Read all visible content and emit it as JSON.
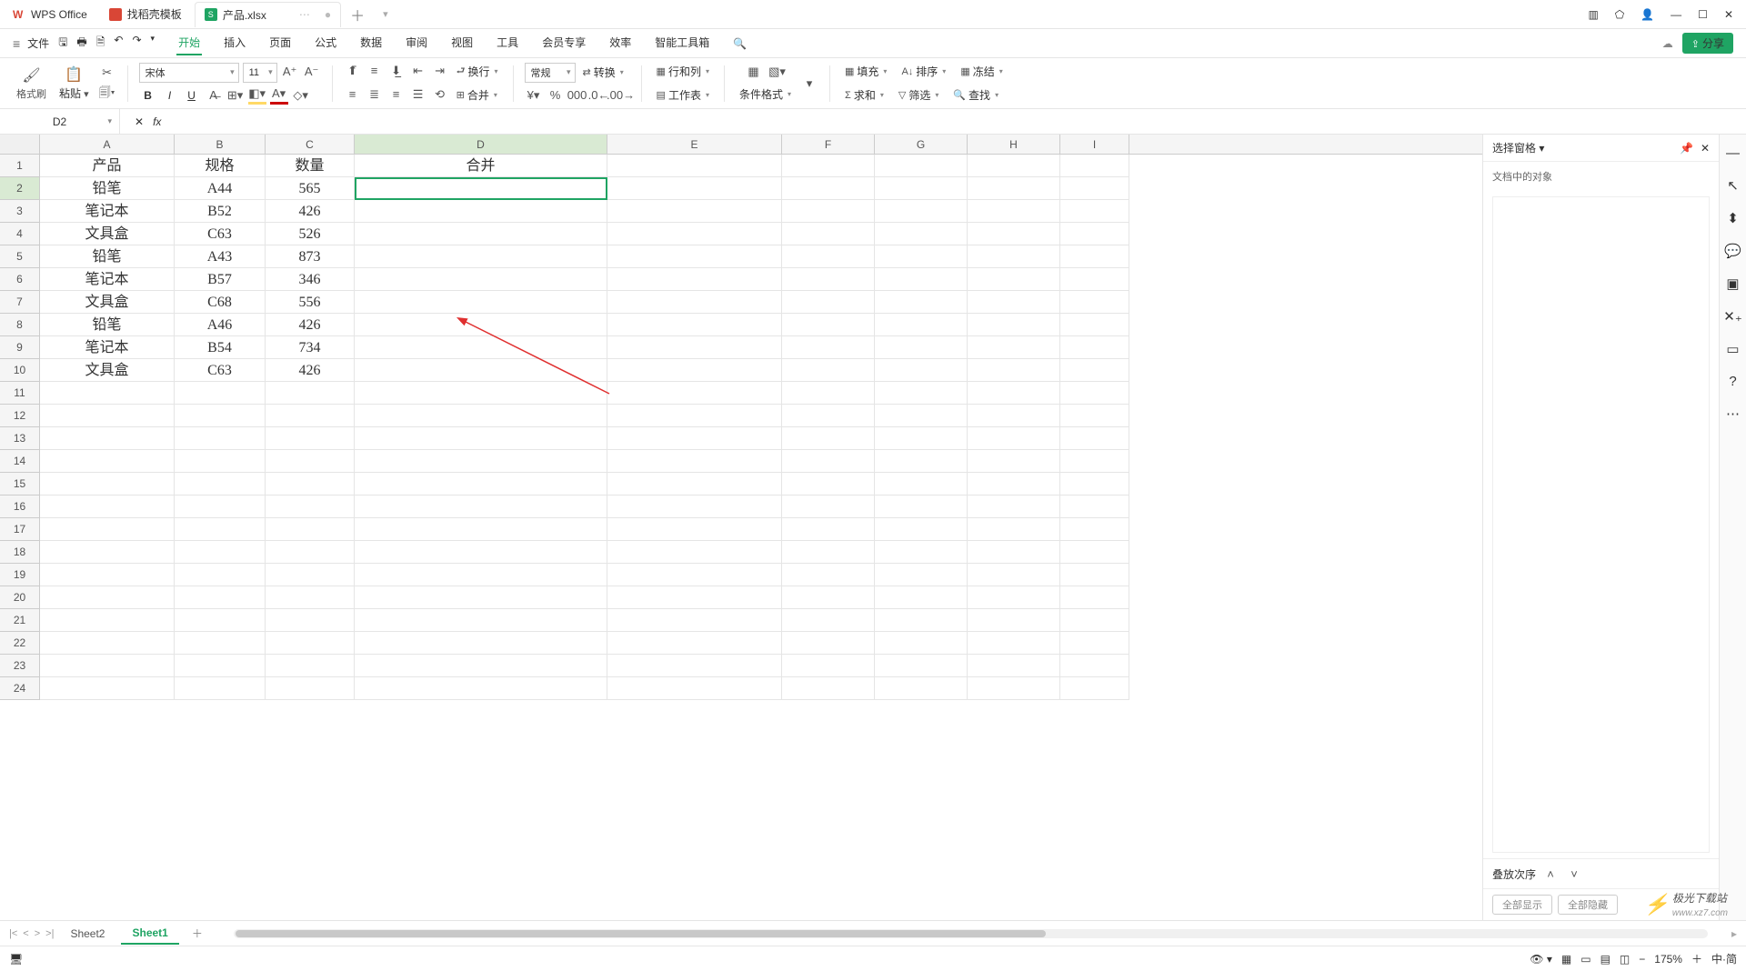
{
  "tabs": {
    "wps": "WPS Office",
    "tpl": "找稻壳模板",
    "file": "产品.xlsx",
    "file_badge": "S"
  },
  "menubar": {
    "file": "文件",
    "items": [
      "开始",
      "插入",
      "页面",
      "公式",
      "数据",
      "审阅",
      "视图",
      "工具",
      "会员专享",
      "效率",
      "智能工具箱"
    ],
    "active": 0,
    "share": "分享"
  },
  "ribbon": {
    "format_painter": "格式刷",
    "paste": "粘贴",
    "font_name": "宋体",
    "font_size": "11",
    "merge": "合并",
    "wrap": "换行",
    "number_format": "常规",
    "convert": "转换",
    "rowcol": "行和列",
    "worksheet": "工作表",
    "cond_fmt": "条件格式",
    "fill": "填充",
    "sort": "排序",
    "freeze": "冻结",
    "sum": "求和",
    "filter": "筛选",
    "find": "查找"
  },
  "namebox": "D2",
  "fx": "fx",
  "columns": [
    "A",
    "B",
    "C",
    "D",
    "E",
    "F",
    "G",
    "H",
    "I"
  ],
  "row_count": 24,
  "data": {
    "header": [
      "产品",
      "规格",
      "数量",
      "合并"
    ],
    "rows": [
      [
        "铅笔",
        "A44",
        "565"
      ],
      [
        "笔记本",
        "B52",
        "426"
      ],
      [
        "文具盒",
        "C63",
        "526"
      ],
      [
        "铅笔",
        "A43",
        "873"
      ],
      [
        "笔记本",
        "B57",
        "346"
      ],
      [
        "文具盒",
        "C68",
        "556"
      ],
      [
        "铅笔",
        "A46",
        "426"
      ],
      [
        "笔记本",
        "B54",
        "734"
      ],
      [
        "文具盒",
        "C63",
        "426"
      ]
    ]
  },
  "task_pane": {
    "title": "选择窗格",
    "subtitle": "文档中的对象",
    "order": "叠放次序",
    "show_all": "全部显示",
    "hide_all": "全部隐藏"
  },
  "sheets": {
    "list": [
      "Sheet2",
      "Sheet1"
    ],
    "active": 1
  },
  "status": {
    "zoom": "175%",
    "lang": "中·简"
  },
  "watermark": {
    "brand": "极光下载站",
    "url": "www.xz7.com"
  },
  "chart_data": {
    "type": "table",
    "title": "产品",
    "columns": [
      "产品",
      "规格",
      "数量"
    ],
    "rows": [
      [
        "铅笔",
        "A44",
        565
      ],
      [
        "笔记本",
        "B52",
        426
      ],
      [
        "文具盒",
        "C63",
        526
      ],
      [
        "铅笔",
        "A43",
        873
      ],
      [
        "笔记本",
        "B57",
        346
      ],
      [
        "文具盒",
        "C68",
        556
      ],
      [
        "铅笔",
        "A46",
        426
      ],
      [
        "笔记本",
        "B54",
        734
      ],
      [
        "文具盒",
        "C63",
        426
      ]
    ]
  }
}
